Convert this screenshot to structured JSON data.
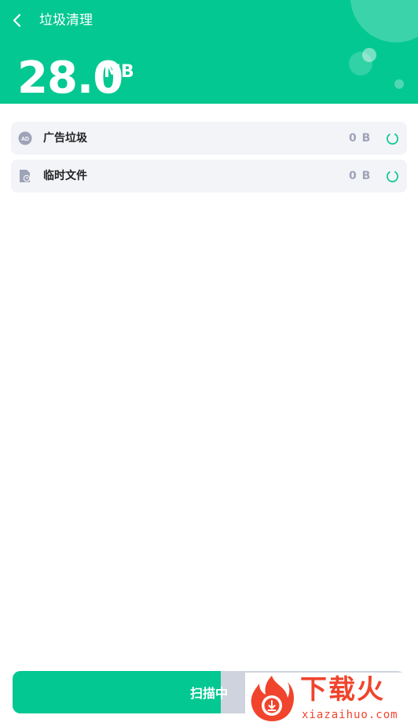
{
  "header": {
    "title": "垃圾清理",
    "total_size": "28.0",
    "total_unit": "MB",
    "background_color": "#04c892"
  },
  "items": [
    {
      "label": "广告垃圾",
      "size": "0 B",
      "icon": "ad-icon",
      "status_icon": "loading-spinner-icon"
    },
    {
      "label": "临时文件",
      "size": "0 B",
      "icon": "temp-file-icon",
      "status_icon": "loading-spinner-icon"
    }
  ],
  "scan_button": {
    "label": "扫描中",
    "progress": 0.53,
    "fill_color": "#04c892",
    "track_color": "#cfd3dd"
  },
  "watermark": {
    "text": "下载火",
    "sub": "xiazaihuo.com",
    "color": "#f0442c"
  }
}
